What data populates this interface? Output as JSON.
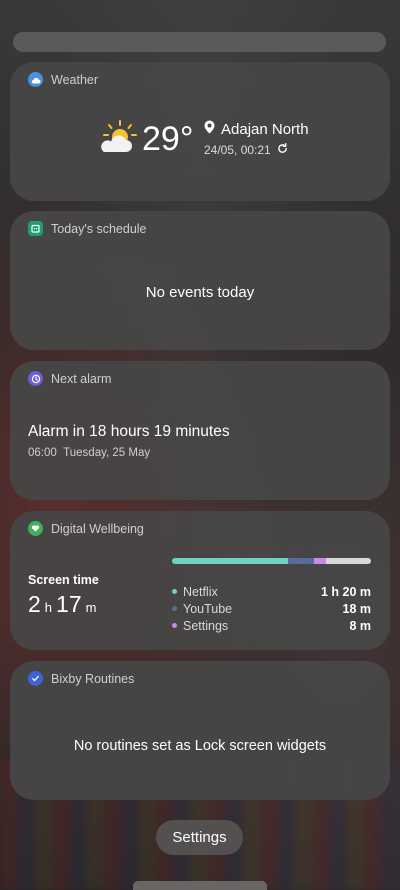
{
  "weather": {
    "title": "Weather",
    "temperature": "29°",
    "location": "Adajan North",
    "updated": "24/05, 00:21"
  },
  "schedule": {
    "title": "Today's schedule",
    "empty_text": "No events today"
  },
  "alarm": {
    "title": "Next alarm",
    "summary": "Alarm in 18 hours 19 minutes",
    "time": "06:00",
    "date": "Tuesday, 25 May"
  },
  "wellbeing": {
    "title": "Digital Wellbeing",
    "screen_time_label": "Screen time",
    "hours": "2",
    "hours_unit": "h",
    "minutes": "17",
    "minutes_unit": "m",
    "apps": [
      {
        "name": "Netflix",
        "time": "1 h 20 m",
        "minutes": 80,
        "color": "#6fd3c2"
      },
      {
        "name": "YouTube",
        "time": "18 m",
        "minutes": 18,
        "color": "#5b6b9a"
      },
      {
        "name": "Settings",
        "time": "8 m",
        "minutes": 8,
        "color": "#c58be6"
      }
    ],
    "other_color": "#d9d9d9"
  },
  "routines": {
    "title": "Bixby Routines",
    "empty_text": "No routines set as Lock screen widgets"
  },
  "settings_button": "Settings",
  "colors": {
    "weather_icon": "#4a90e2",
    "schedule_icon": "#1e9e74",
    "alarm_icon": "#6a5fd6",
    "wellbeing_icon": "#41b05a",
    "routines_icon": "#3d63d6"
  }
}
